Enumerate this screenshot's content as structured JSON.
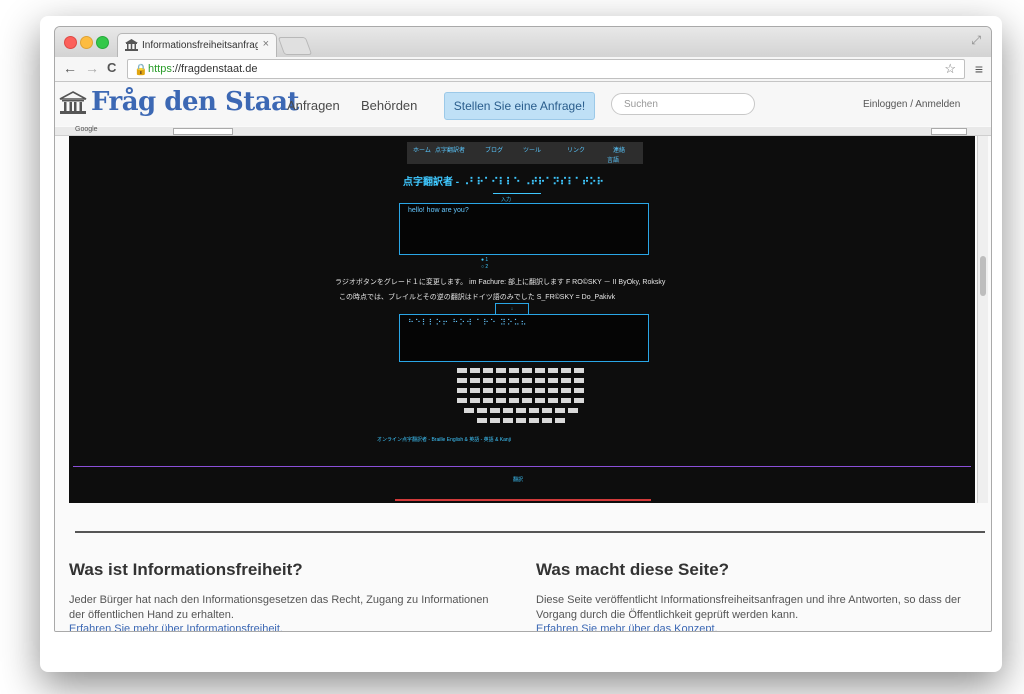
{
  "browser": {
    "tab_title": "Informationsfreiheitsanfrage",
    "tab_close": "×",
    "url_https": "https",
    "url_rest": "://fragdenstaat.de",
    "nav_back": "←",
    "nav_forward": "→",
    "nav_reload": "C",
    "lock_icon": "🔒",
    "star_icon": "☆",
    "menu_icon": "≡",
    "fullscreen_icon": "⤢"
  },
  "site": {
    "brand": "Fråg den Staat",
    "nav": [
      "Anfragen",
      "Behörden"
    ],
    "cta": "Stellen Sie eine Anfrage!",
    "search_placeholder": "Suchen",
    "login": "Einloggen / Anmelden"
  },
  "google_bar": {
    "label": "Google"
  },
  "embedded": {
    "title": "点字翻訳者 - ⠠⠃⠗⠁⠊⠇⠇⠑ ⠠⠞⠗⠁⠝⠎⠇⠁⠞⠕⠗",
    "input_text": "hello! how are you?",
    "message_line1": "ラジオボタンをグレード１に変更します。 im Fachure: 部上に翻訳します F RO©SKY － II ByOky, Roksky",
    "message_line2": "この時点では、ブレイルとその逆の翻訳はドイツ語のみでした S_FR©SKY = Do_Pakivk",
    "output_text": "⠓⠑⠇⠇⠕⠖ ⠓⠕⠺ ⠁⠗⠑ ⠽⠕⠥⠦",
    "footer_links": "オンライン点字翻訳者 - Braille  English & 英語 - 英語 & Kanji",
    "more": "翻訳"
  },
  "sections": [
    {
      "heading": "Was ist Informationsfreiheit?",
      "body": "Jeder Bürger hat nach den Informationsgesetzen das Recht, Zugang zu Informationen der öffentlichen Hand zu erhalten.",
      "link": "Erfahren Sie mehr über Informationsfreiheit."
    },
    {
      "heading": "Was macht diese Seite?",
      "body": "Diese Seite veröffentlicht Informationsfreiheitsanfragen und ihre Antworten, so dass der Vorgang durch die Öffentlichkeit geprüft werden kann.",
      "link": "Erfahren Sie mehr über das Konzept."
    }
  ],
  "colors": {
    "brand_blue": "#3c68b4",
    "cta_bg": "#bfe0f6",
    "embedded_bg": "#0d0d0d",
    "embedded_accent": "#3fc8ff"
  }
}
